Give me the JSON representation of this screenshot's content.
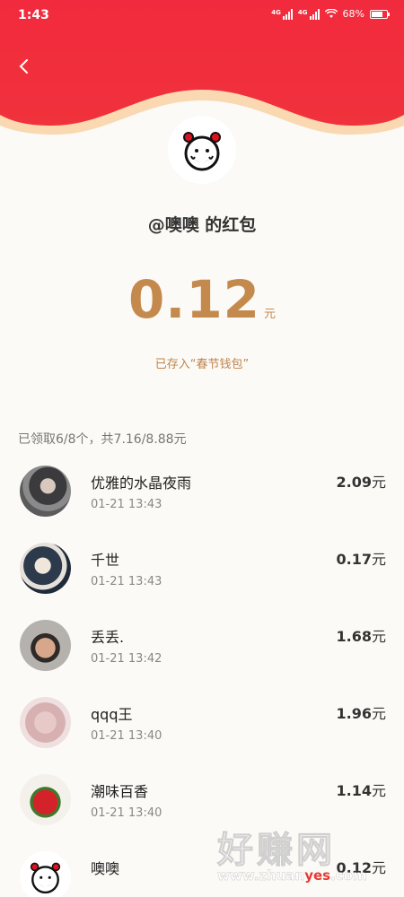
{
  "status_bar": {
    "time": "1:43",
    "signal_tag": "4G",
    "battery": "68%"
  },
  "header": {
    "title": "@噢噢 的红包"
  },
  "red_packet": {
    "amount": "0.12",
    "unit": "元",
    "saved_text": "已存入“春节钱包”"
  },
  "summary": "已领取6/8个，共7.16/8.88元",
  "claims": [
    {
      "name": "优雅的水晶夜雨",
      "time": "01-21 13:43",
      "amount": "2.09",
      "unit": "元"
    },
    {
      "name": "千世",
      "time": "01-21 13:43",
      "amount": "0.17",
      "unit": "元"
    },
    {
      "name": "丢丢.",
      "time": "01-21 13:42",
      "amount": "1.68",
      "unit": "元"
    },
    {
      "name": "qqq王",
      "time": "01-21 13:40",
      "amount": "1.96",
      "unit": "元"
    },
    {
      "name": "潮味百香",
      "time": "01-21 13:40",
      "amount": "1.14",
      "unit": "元"
    },
    {
      "name": "噢噢",
      "time": "",
      "amount": "0.12",
      "unit": "元"
    }
  ],
  "watermark": {
    "brand": "好赚网",
    "url_prefix": "www.zhuan",
    "url_highlight": "yes",
    "url_suffix": ".com"
  },
  "colors": {
    "header_red": "#f0323c",
    "amount_gold": "#c48a4d",
    "background": "#fbfaf6"
  }
}
